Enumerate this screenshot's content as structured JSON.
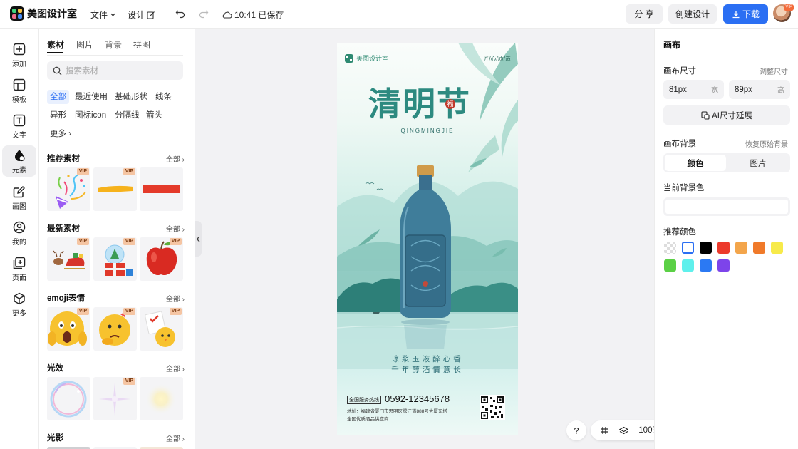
{
  "app": {
    "name": "美图设计室"
  },
  "topbar": {
    "file_menu": "文件",
    "design_menu": "设计",
    "save_status": "10:41 已保存",
    "share": "分 享",
    "create_design": "创建设计",
    "download": "下载",
    "avatar_badge": "VIP"
  },
  "left_nav": [
    {
      "label": "添加",
      "icon": "plus-square-icon"
    },
    {
      "label": "模板",
      "icon": "template-icon"
    },
    {
      "label": "文字",
      "icon": "text-icon"
    },
    {
      "label": "元素",
      "icon": "shapes-icon"
    },
    {
      "label": "画图",
      "icon": "draw-icon"
    },
    {
      "label": "我的",
      "icon": "user-icon"
    },
    {
      "label": "页面",
      "icon": "add-page-icon"
    },
    {
      "label": "更多",
      "icon": "cube-icon"
    }
  ],
  "panel": {
    "tabs": [
      "素材",
      "图片",
      "背景",
      "拼图"
    ],
    "search_placeholder": "搜索素材",
    "chips": [
      "全部",
      "最近使用",
      "基础形状",
      "线条",
      "异形",
      "图标icon",
      "分隔线",
      "箭头",
      "更多"
    ],
    "sections": [
      {
        "title": "推荐素材",
        "all": "全部"
      },
      {
        "title": "最新素材",
        "all": "全部"
      },
      {
        "title": "emoji表情",
        "all": "全部"
      },
      {
        "title": "光效",
        "all": "全部"
      },
      {
        "title": "光影",
        "all": "全部"
      }
    ],
    "vip_badge": "VIP"
  },
  "poster": {
    "brand": "美图设计室",
    "corner_text": "匠/心/质/造",
    "title": "清明节",
    "title_sub": "QINGMINGJIE",
    "seal": "福",
    "line1": "琼浆玉液醉心香",
    "line2": "千年醇酒情意长",
    "hotline_tag": "全国服务热线",
    "phone": "0592-12345678",
    "address": "地址：福建省厦门市思明区鹭江道888号大厦东塔",
    "address2": "全国优质酒品供应商"
  },
  "zoom": {
    "help": "?",
    "level": "100%"
  },
  "right_panel": {
    "title": "画布",
    "size_label": "画布尺寸",
    "adjust_size": "调整尺寸",
    "width_value": "81px",
    "width_unit": "宽",
    "height_value": "89px",
    "height_unit": "高",
    "ai_expand": "AI尺寸延展",
    "bg_label": "画布背景",
    "restore_bg": "恢复原始背景",
    "tab_color": "颜色",
    "tab_image": "图片",
    "current_bg": "当前背景色",
    "recommended": "推荐颜色",
    "colors_row1": [
      "transparent",
      "#ffffff",
      "#000000",
      "#ec3a2c",
      "#f3a54b",
      "#f07a2a",
      "#f7ea4a"
    ],
    "colors_row2": [
      "#5bd045",
      "#5ff0ec",
      "#2b79f3",
      "#7d44ea"
    ]
  }
}
